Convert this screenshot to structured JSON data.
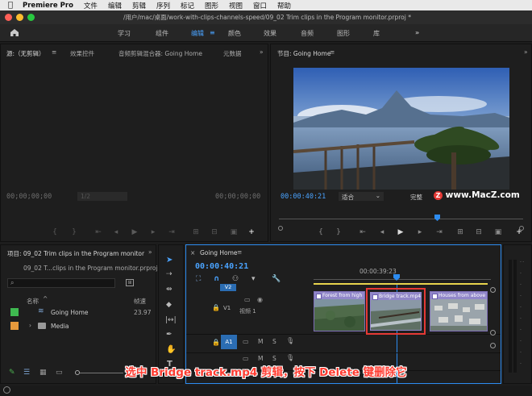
{
  "menubar": {
    "app_name": "Premiere Pro",
    "items": [
      "文件",
      "编辑",
      "剪辑",
      "序列",
      "标记",
      "图形",
      "视图",
      "窗口",
      "帮助"
    ]
  },
  "window": {
    "title": "/用户/mac/桌面/work-with-clips-channels-speed/09_02 Trim clips in the Program monitor.prproj *"
  },
  "workspaces": {
    "tabs": [
      "学习",
      "组件",
      "编辑",
      "颜色",
      "效果",
      "音频",
      "图形",
      "库"
    ],
    "active": "编辑",
    "more": "»"
  },
  "source_panel": {
    "tabs": [
      "源:（无剪辑）",
      "效果控件",
      "音频剪辑混合器: Going Home",
      "元数据"
    ],
    "timecode_left": "00;00;00;00",
    "fit_value": "1/2",
    "timecode_right": "00;00;00;00"
  },
  "program_panel": {
    "title": "节目: Going Home",
    "timecode": "00:00:40:21",
    "fit_value": "适合",
    "resolution": "完整",
    "watermark": "www.MacZ.com"
  },
  "project_panel": {
    "title": "项目: 09_02 Trim clips in the Program monitor",
    "file_name": "09_02 T...clips in the Program monitor.prproj",
    "col_name": "名称",
    "col_framerate": "帧速",
    "items": [
      {
        "name": "Going Home",
        "value": "23.97",
        "color": "#3fb950"
      },
      {
        "name": "Media",
        "value": "",
        "color": "#e89a3c"
      }
    ]
  },
  "timeline": {
    "tab": "Going Home",
    "timecode": "00:00:40:21",
    "ruler_time": "00:00:39:23",
    "tracks": {
      "v2": "V2",
      "v1": "V1",
      "v1_label": "视频 1",
      "a1": "A1",
      "a1_src": "A1",
      "m": "M",
      "s": "S"
    },
    "clips": [
      {
        "name": "Forest from high"
      },
      {
        "name": "Bridge track.mp4"
      },
      {
        "name": "Houses from above"
      }
    ]
  },
  "caption": "选中 Bridge track.mp4 剪辑，按下 Delete 键删除它",
  "colors": {
    "accent": "#2d8cf0",
    "selection": "#e53935",
    "clip_header": "#9187c9"
  }
}
